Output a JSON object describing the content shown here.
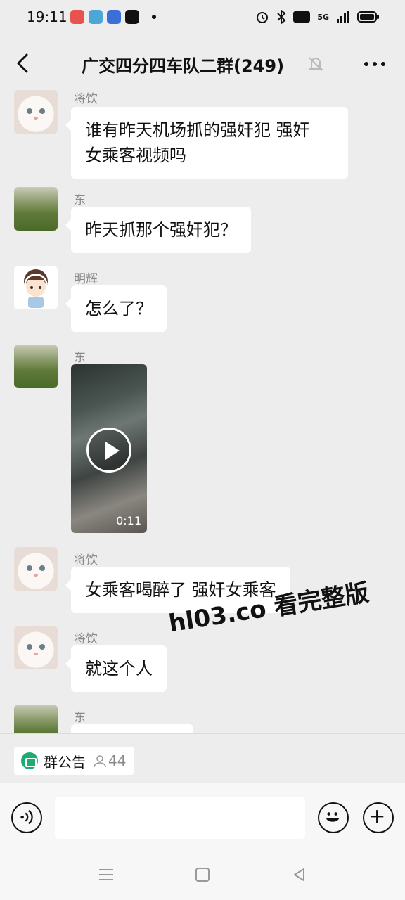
{
  "status_bar": {
    "time": "19:11",
    "signal_text": "5G"
  },
  "header": {
    "title": "广交四分四车队二群(249)"
  },
  "messages": [
    {
      "sender": "将饮",
      "avatar": "white-cat-avatar",
      "type": "text",
      "text_lines": [
        "谁有昨天机场抓的强奸犯 强奸",
        "女乘客视频吗"
      ]
    },
    {
      "sender": "东",
      "avatar": "sunflower-field-avatar",
      "type": "text",
      "text_lines": [
        "昨天抓那个强奸犯？"
      ]
    },
    {
      "sender": "明辉",
      "avatar": "cartoon-boy-avatar",
      "type": "text",
      "text_lines": [
        "怎么了？"
      ]
    },
    {
      "sender": "东",
      "avatar": "sunflower-field-avatar",
      "type": "video",
      "duration": "0:11"
    },
    {
      "sender": "将饮",
      "avatar": "white-cat-avatar",
      "type": "text",
      "text_lines": [
        "女乘客喝醉了 强奸女乘客"
      ]
    },
    {
      "sender": "将饮",
      "avatar": "white-cat-avatar",
      "type": "text",
      "text_lines": [
        "就这个人"
      ]
    },
    {
      "sender": "东",
      "avatar": "sunflower-field-avatar",
      "type": "text",
      "text_lines": [
        ""
      ]
    }
  ],
  "watermark": "hl03.co 看完整版",
  "announcement": {
    "label": "群公告",
    "member_count": "44"
  },
  "input": {
    "placeholder": ""
  },
  "colors": {
    "background": "#ededed",
    "bubble": "#ffffff",
    "announce_green": "#1aad6f"
  }
}
